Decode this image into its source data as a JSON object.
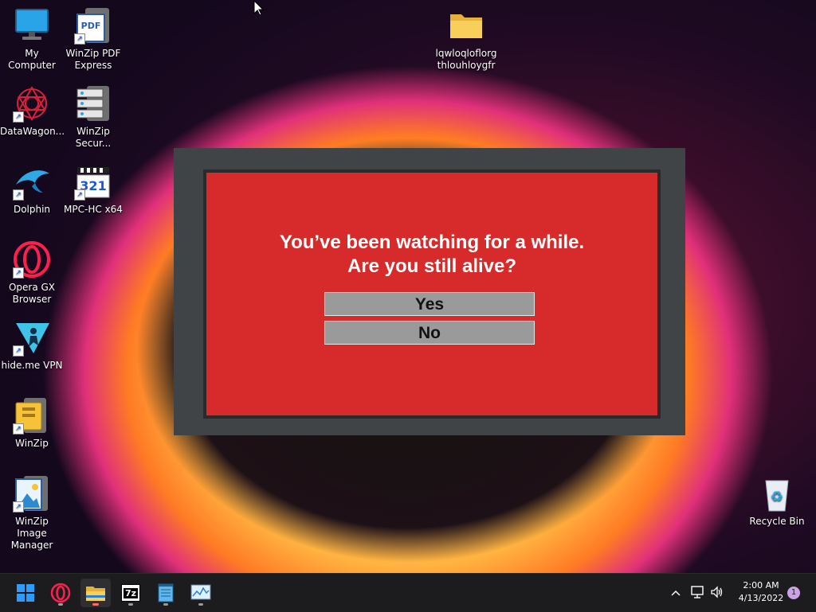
{
  "desktop": {
    "icons": [
      {
        "label": "My Computer"
      },
      {
        "label": "WinZip PDF Express"
      },
      {
        "label": "DataWagon..."
      },
      {
        "label": "WinZip Secur..."
      },
      {
        "label": "Dolphin"
      },
      {
        "label": "MPC-HC x64"
      },
      {
        "label": "Opera GX Browser"
      },
      {
        "label": "hide.me VPN"
      },
      {
        "label": "WinZip"
      },
      {
        "label": "WinZip Image Manager"
      },
      {
        "label": "lqwloqloflorg thlouhloygfr"
      },
      {
        "label": "Recycle Bin"
      }
    ],
    "pdf_badge": "PDF",
    "mpc_badge": "321"
  },
  "dialog": {
    "line1": "You’ve been watching for a while.",
    "line2": "Are you still alive?",
    "yes_label": "Yes",
    "no_label": "No",
    "colors": {
      "frame": "#404447",
      "panel": "#d72a2a",
      "button": "#9a9a9a"
    }
  },
  "taskbar": {
    "apps": [
      {
        "icon": "windows-start-icon"
      },
      {
        "icon": "opera-gx-icon"
      },
      {
        "icon": "file-explorer-icon"
      },
      {
        "icon": "7zip-icon",
        "badge": "7z"
      },
      {
        "icon": "notepad-icon"
      },
      {
        "icon": "resource-monitor-icon"
      }
    ],
    "clock_time": "2:00 AM",
    "clock_date": "4/13/2022",
    "notification_count": "1"
  }
}
